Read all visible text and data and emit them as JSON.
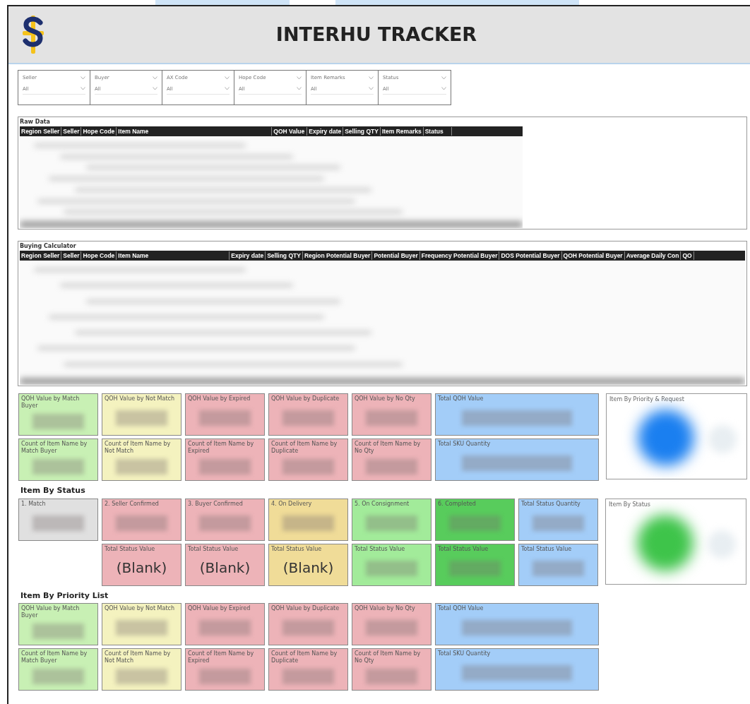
{
  "header": {
    "title": "INTERHU TRACKER"
  },
  "filters": [
    {
      "label": "Seller",
      "value": "All"
    },
    {
      "label": "Buyer",
      "value": "All"
    },
    {
      "label": "AX Code",
      "value": "All"
    },
    {
      "label": "Hope Code",
      "value": "All"
    },
    {
      "label": "Item Remarks",
      "value": "All"
    },
    {
      "label": "Status",
      "value": "All"
    }
  ],
  "raw_data": {
    "title": "Raw Data",
    "columns": [
      "Region Seller",
      "Seller",
      "Hope Code",
      "Item Name",
      "QOH Value",
      "Expiry date",
      "Selling QTY",
      "Item Remarks",
      "Status"
    ]
  },
  "buying_calculator": {
    "title": "Buying Calculator",
    "columns": [
      "Region Seller",
      "Seller",
      "Hope Code",
      "Item Name",
      "Expiry date",
      "Selling QTY",
      "Region Potential Buyer",
      "Potential Buyer",
      "Frequency Potential Buyer",
      "DOS Potential Buyer",
      "QOH Potential Buyer",
      "Average Daily Con",
      "QO"
    ]
  },
  "summary": {
    "columns": [
      {
        "cards": [
          {
            "label": "QOH Value by Match Buyer",
            "color": "#c8f0b4"
          },
          {
            "label": "Count of Item Name by Match Buyer",
            "color": "#c8f0b4"
          }
        ]
      },
      {
        "cards": [
          {
            "label": "QOH Value by Not Match",
            "color": "#f4f2bf"
          },
          {
            "label": "Count of Item Name by Not Match",
            "color": "#f4f2bf"
          }
        ]
      },
      {
        "cards": [
          {
            "label": "QOH Value by Expired",
            "color": "#edb3b8"
          },
          {
            "label": "Count of Item Name by Expired",
            "color": "#edb3b8"
          }
        ]
      },
      {
        "cards": [
          {
            "label": "QOH Value by Duplicate",
            "color": "#edb3b8"
          },
          {
            "label": "Count of Item Name by Duplicate",
            "color": "#edb3b8"
          }
        ]
      },
      {
        "cards": [
          {
            "label": "QOH Value by No Qty",
            "color": "#edb3b8"
          },
          {
            "label": "Count of Item Name by No Qty",
            "color": "#edb3b8"
          }
        ]
      },
      {
        "cards": [
          {
            "label": "Total QOH Value",
            "color": "#a3cdf8"
          },
          {
            "label": "Total SKU Quantity",
            "color": "#a3cdf8"
          }
        ]
      }
    ],
    "chart": {
      "title": "Item By Priority & Request"
    }
  },
  "item_by_status": {
    "title": "Item By Status",
    "columns": [
      {
        "cards": [
          {
            "label": "1. Match",
            "color": "#e0e0e0"
          }
        ]
      },
      {
        "cards": [
          {
            "label": "2. Seller Confirmed",
            "color": "#edb3b8"
          },
          {
            "label": "Total Status Value",
            "color": "#edb3b8",
            "value": "(Blank)"
          }
        ]
      },
      {
        "cards": [
          {
            "label": "3. Buyer Confirmed",
            "color": "#edb3b8"
          },
          {
            "label": "Total Status Value",
            "color": "#edb3b8",
            "value": "(Blank)"
          }
        ]
      },
      {
        "cards": [
          {
            "label": "4. On Delivery",
            "color": "#f0dc98"
          },
          {
            "label": "Total Status Value",
            "color": "#f0dc98",
            "value": "(Blank)"
          }
        ]
      },
      {
        "cards": [
          {
            "label": "5. On Consignment",
            "color": "#a2eb9a"
          },
          {
            "label": "Total Status Value",
            "color": "#a2eb9a"
          }
        ]
      },
      {
        "cards": [
          {
            "label": "6. Completed",
            "color": "#58cc5c"
          },
          {
            "label": "Total Status Value",
            "color": "#58cc5c"
          }
        ]
      },
      {
        "cards": [
          {
            "label": "Total Status Quantity",
            "color": "#a3cdf8"
          },
          {
            "label": "Total Status Value",
            "color": "#a3cdf8"
          }
        ]
      }
    ],
    "chart": {
      "title": "Item By Status"
    }
  },
  "item_by_priority_list": {
    "title": "Item By Priority List",
    "columns": [
      {
        "cards": [
          {
            "label": "QOH Value by Match Buyer",
            "color": "#c8f0b4"
          },
          {
            "label": "Count of Item Name by Match Buyer",
            "color": "#c8f0b4"
          }
        ]
      },
      {
        "cards": [
          {
            "label": "QOH Value by Not Match",
            "color": "#f4f2bf"
          },
          {
            "label": "Count of Item Name by Not Match",
            "color": "#f4f2bf"
          }
        ]
      },
      {
        "cards": [
          {
            "label": "QOH Value by Expired",
            "color": "#edb3b8"
          },
          {
            "label": "Count of Item Name by Expired",
            "color": "#edb3b8"
          }
        ]
      },
      {
        "cards": [
          {
            "label": "QOH Value by Duplicate",
            "color": "#edb3b8"
          },
          {
            "label": "Count of Item Name by Duplicate",
            "color": "#edb3b8"
          }
        ]
      },
      {
        "cards": [
          {
            "label": "QOH Value by No Qty",
            "color": "#edb3b8"
          },
          {
            "label": "Count of Item Name by No Qty",
            "color": "#edb3b8"
          }
        ]
      },
      {
        "cards": [
          {
            "label": "Total QOH Value",
            "color": "#a3cdf8"
          },
          {
            "label": "Total SKU Quantity",
            "color": "#a3cdf8"
          }
        ]
      }
    ]
  }
}
